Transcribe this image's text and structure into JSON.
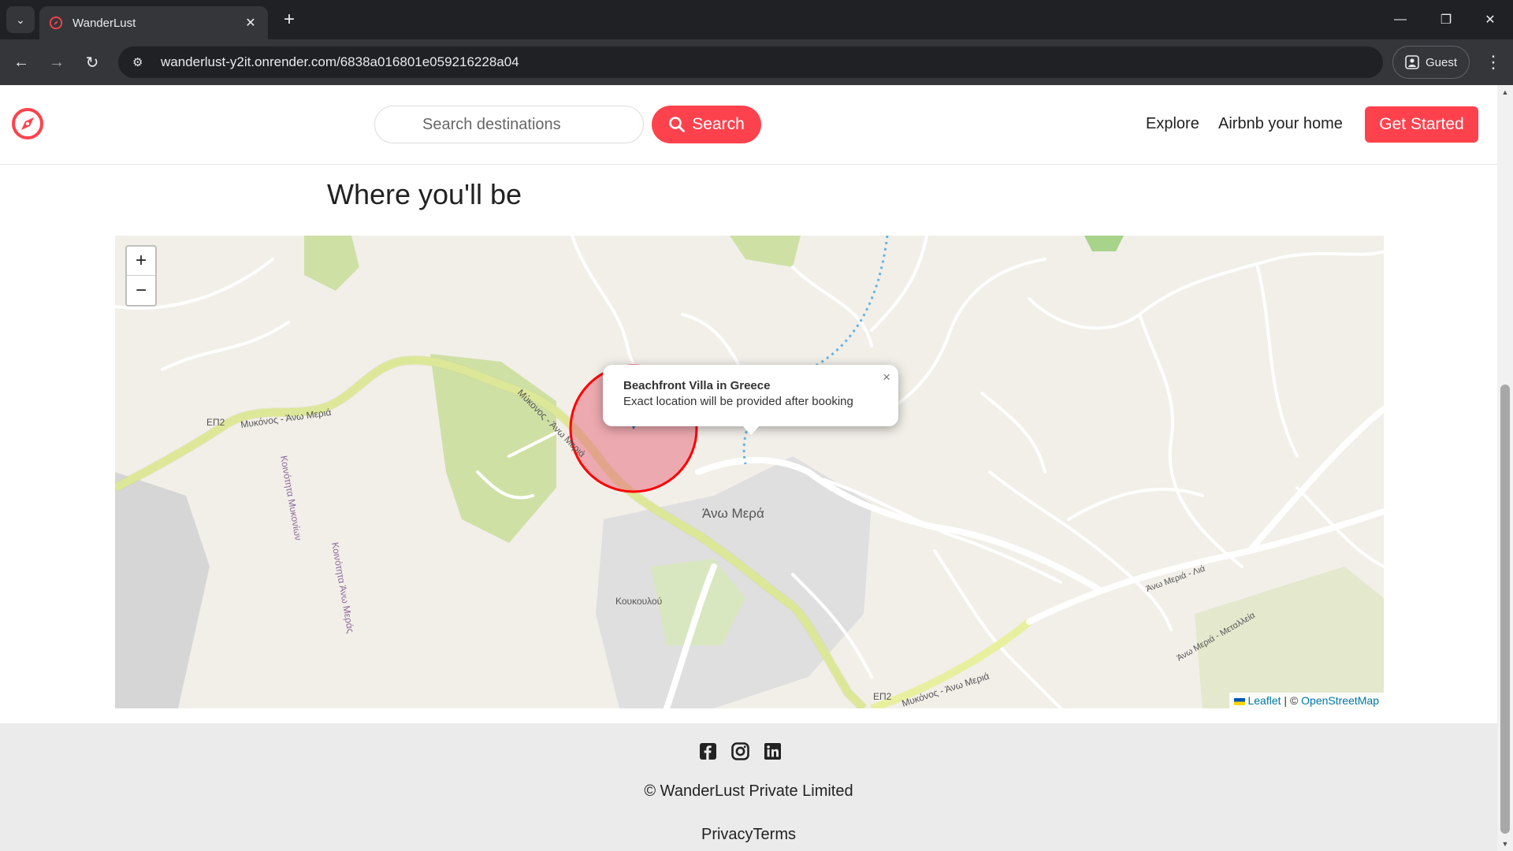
{
  "browser": {
    "tab_title": "WanderLust",
    "url": "wanderlust-y2it.onrender.com/6838a016801e059216228a04",
    "profile_label": "Guest"
  },
  "navbar": {
    "search_placeholder": "Search destinations",
    "search_label": "Search",
    "explore_label": "Explore",
    "host_label": "Airbnb your home",
    "cta_label": "Get Started"
  },
  "section": {
    "title": "Where you'll be"
  },
  "map": {
    "popup_title": "Beachfront Villa in Greece",
    "popup_text": "Exact location will be provided after booking",
    "attribution_leaflet": "Leaflet",
    "attribution_osm": "OpenStreetMap",
    "labels": {
      "road_ref_1": "ΕΠ2",
      "road_name_1": "Μυκόνος - Άνω Μεριά",
      "road_name_2": "Μύκονος - Άνω Μεριά",
      "village": "Άνω Μερά",
      "hamlet": "Κουκουλού",
      "road_ref_2": "ΕΠ2",
      "road_name_3": "Μυκόνος - Άνω Μεριά",
      "road_name_4": "Άνω Μεριά - Λιά",
      "road_name_5": "Άνω Μεριά - Μεταλλεία",
      "community_1": "Κοινότητα Μυκονίων",
      "community_2": "Κοινότητα Άνω Μεράς"
    },
    "accent_color": "#ff0000",
    "marker_color": "#2a81cb"
  },
  "footer": {
    "copyright": "© WanderLust Private Limited",
    "links": "PrivacyTerms",
    "socials": [
      "facebook-icon",
      "instagram-icon",
      "linkedin-icon"
    ]
  },
  "colors": {
    "brand": "#fe424d"
  }
}
